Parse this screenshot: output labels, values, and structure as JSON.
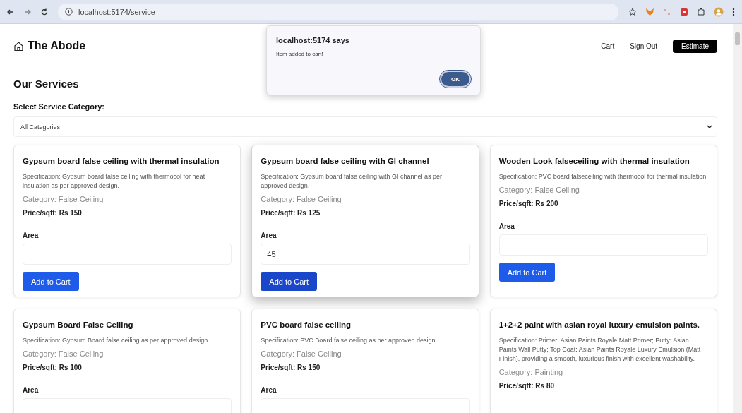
{
  "browser": {
    "url": "localhost:5174/service"
  },
  "header": {
    "brand": "The Abode",
    "nav": [
      "Cart",
      "Sign Out"
    ],
    "cta": "Estimate"
  },
  "page_title": "Our Services",
  "category_select": {
    "label": "Select Service Category:",
    "value": "All Categories"
  },
  "services": [
    {
      "title": "Gypsum board false ceiling with thermal insulation",
      "specification": "Specification: Gypsum board false ceiling with thermocol for heat insulation as per approved design.",
      "category": "Category: False Ceiling",
      "price": "Price/sqft: Rs 150",
      "area_label": "Area",
      "button": "Add to Cart",
      "focused": false
    },
    {
      "title": "Gypsum board false ceiling with GI channel",
      "specification": "Specification: Gypsum board false ceiling with GI channel as per approved design.",
      "category": "Category: False Ceiling",
      "price": "Price/sqft: Rs 125",
      "area_label": "Area",
      "area_value": "45",
      "button": "Add to Cart",
      "focused": true
    },
    {
      "title": "Wooden Look falseceiling with thermal insulation",
      "specification": "Specification: PVC board falseceiling with thermocol for thermal insulation",
      "category": "Category: False Ceiling",
      "price": "Price/sqft: Rs 200",
      "area_label": "Area",
      "button": "Add to Cart",
      "focused": false
    },
    {
      "title": "Gypsum Board False Ceiling",
      "specification": "Specification: Gypsum Board false ceiling as per approved design.",
      "category": "Category: False Ceiling",
      "price": "Price/sqft: Rs 100",
      "area_label": "Area",
      "focused": false
    },
    {
      "title": "PVC board false ceiling",
      "specification": "Specification: PVC Board false ceiling as per approved design.",
      "category": "Category: False Ceiling",
      "price": "Price/sqft: Rs 150",
      "area_label": "Area",
      "focused": false
    },
    {
      "title": "1+2+2 paint with asian royal luxury emulsion paints.",
      "specification": "Specification: Primer: Asian Paints Royale Matt Primer; Putty: Asian Paints Wall Putty; Top Coat: Asian Paints Royale Luxury Emulsion (Matt Finish), providing a smooth, luxurious finish with excellent washability.",
      "category": "Category: Painting",
      "price": "Price/sqft: Rs 80",
      "focused": false
    }
  ],
  "dialog": {
    "title": "localhost:5174 says",
    "message": "Item added to cart!",
    "button": "OK"
  }
}
